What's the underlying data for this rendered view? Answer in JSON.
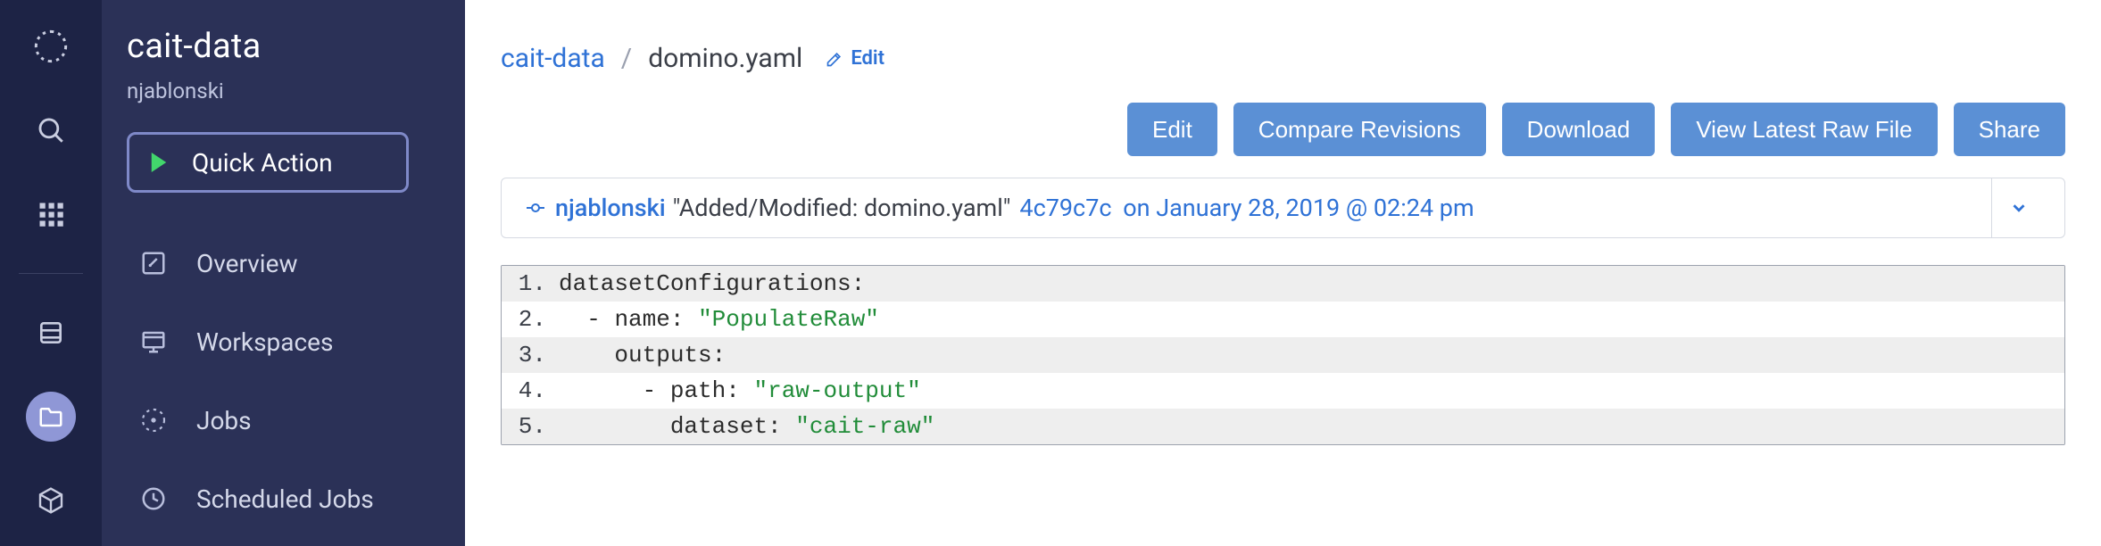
{
  "rail": {
    "items": [
      "logo",
      "search",
      "apps",
      "database",
      "files",
      "cube"
    ],
    "active_index": 4
  },
  "sidebar": {
    "project_title": "cait-data",
    "project_owner": "njablonski",
    "quick_action_label": "Quick Action",
    "nav": [
      {
        "label": "Overview"
      },
      {
        "label": "Workspaces"
      },
      {
        "label": "Jobs"
      },
      {
        "label": "Scheduled Jobs"
      }
    ]
  },
  "breadcrumb": {
    "project": "cait-data",
    "separator": "/",
    "file": "domino.yaml",
    "edit_label": "Edit"
  },
  "actions": {
    "edit": "Edit",
    "compare": "Compare Revisions",
    "download": "Download",
    "view_raw": "View Latest Raw File",
    "share": "Share"
  },
  "commit": {
    "author": "njablonski",
    "message": "\"Added/Modified: domino.yaml\"",
    "hash": "4c79c7c",
    "timestamp": "on January 28, 2019 @ 02:24 pm"
  },
  "code": {
    "lines": [
      {
        "n": "1.",
        "indent": "",
        "pre": "datasetConfigurations",
        "colon": ":"
      },
      {
        "n": "2.",
        "indent": "  ",
        "dash": "- ",
        "pre": "name",
        "colon": ": ",
        "str": "\"PopulateRaw\""
      },
      {
        "n": "3.",
        "indent": "    ",
        "pre": "outputs",
        "colon": ":"
      },
      {
        "n": "4.",
        "indent": "      ",
        "dash": "- ",
        "pre": "path",
        "colon": ": ",
        "str": "\"raw-output\""
      },
      {
        "n": "5.",
        "indent": "        ",
        "pre": "dataset",
        "colon": ": ",
        "str": "\"cait-raw\""
      }
    ]
  }
}
